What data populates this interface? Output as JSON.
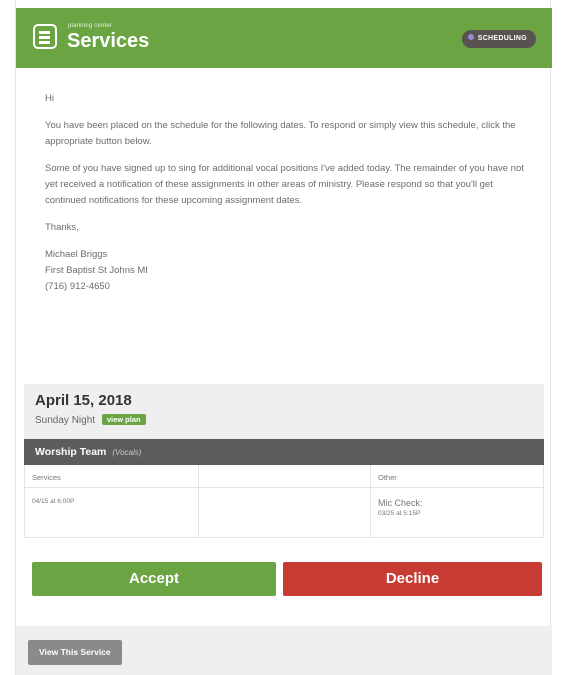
{
  "header": {
    "logo_small": "planning center",
    "logo_main": "Services",
    "badge": "SCHEDULING"
  },
  "message": {
    "greeting": "Hi",
    "para1": "You have been placed on the schedule for the following dates. To respond or simply view this schedule, click the appropriate button below.",
    "para2": "Some of you have signed up to sing for additional vocal positions I've added today. The remainder of you have not yet received a notification of these assignments in other areas of ministry. Please respond so that you'll get continued notifications for these upcoming assignment dates.",
    "thanks": "Thanks,",
    "signature": {
      "name": "Michael Briggs",
      "church": "First Baptist St Johns MI",
      "phone": "(716) 912-4650"
    }
  },
  "plan": {
    "date": "April 15, 2018",
    "service_type": "Sunday Night",
    "view_plan": "view plan"
  },
  "team": {
    "name": "Worship Team",
    "position": "(Vocals)"
  },
  "table": {
    "col1_header": "Services",
    "col3_header": "Other",
    "service_time": "04/15 at 6:00P",
    "other_title": "Mic Check:",
    "other_time": "03/25 at 5:15P"
  },
  "actions": {
    "accept": "Accept",
    "decline": "Decline",
    "view_service": "View This Service"
  },
  "colors": {
    "brand_green": "#6aa443",
    "decline_red": "#c73b33",
    "team_bar": "#5c5c5c"
  }
}
